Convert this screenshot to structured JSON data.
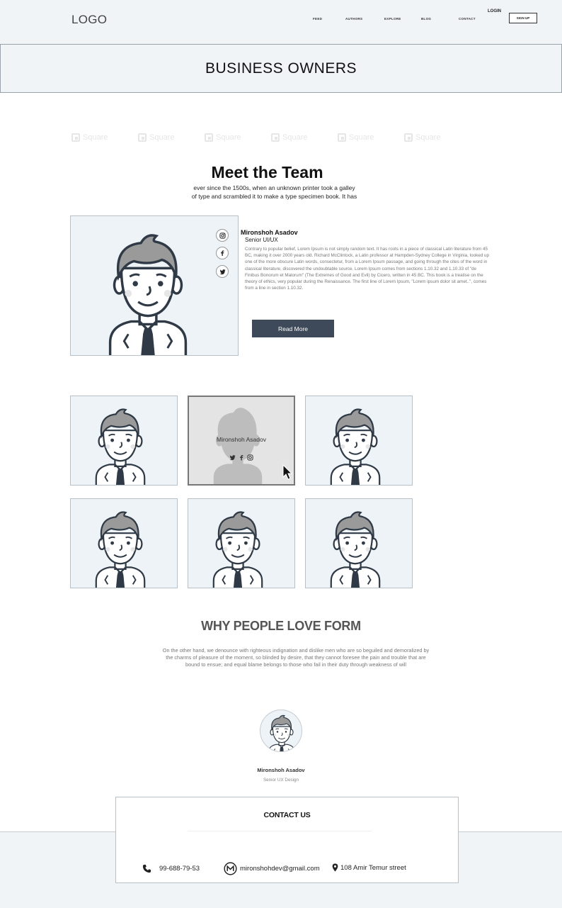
{
  "header": {
    "logo": "LOGO",
    "nav": [
      "FEED",
      "AUTHORS",
      "EXPLORE",
      "BLOG",
      "CONTACT"
    ],
    "login": "LOGIN",
    "signup": "SIGN UP"
  },
  "banner": {
    "title": "BUSINESS OWNERS"
  },
  "watermark": {
    "label": "Square",
    "count": 6
  },
  "team": {
    "title": "Meet the Team",
    "subtitle": "ever since the 1500s, when an unknown printer took a galley of type and scrambled it to make a type specimen book. It has",
    "featured": {
      "name": "Mironshoh Asadov",
      "role": "Senior UI/UX",
      "bio": "Contrary to popular belief, Lorem Ipsum is not simply random text. It has roots in a piece of classical Latin literature from 45 BC, making it over 2000 years old. Richard McClintock, a Latin professor at Hampden-Sydney College in Virginia, looked up one of the more obscure Latin words, consectetur, from a Lorem Ipsum passage, and going through the cites of the word in classical literature, discovered the undoubtable source. Lorem Ipsum comes from sections 1.10.32 and 1.10.33 of \"de Finibus Bonorum et Malorum\" (The Extremes of Good and Evil) by Cicero, written in 45 BC. This book is a treatise on the theory of ethics, very popular during the Renaissance. The first line of Lorem Ipsum, \"Lorem ipsum dolor sit amet..\", comes from a line in section 1.10.32.",
      "read_more": "Read More",
      "social_icons": [
        "instagram-icon",
        "facebook-icon",
        "twitter-icon"
      ]
    },
    "hover_card_name": "Mironshoh Asadov"
  },
  "why": {
    "title": "WHY PEOPLE LOVE FORM",
    "text": "On the other hand, we denounce with righteous indignation and dislike men who are so beguiled and demoralized by the charms of pleasure of the moment, so blinded by desire, that they cannot foresee the pain and trouble that are bound to ensue; and equal blame belongs to those who fail in their duty through weakness of will"
  },
  "testimonial": {
    "name": "Mironshoh Asadov",
    "role": "Senior UX Design"
  },
  "contact": {
    "title": "CONTACT US",
    "phone": "99-688-79-53",
    "email": "mironshohdev@gmail.com",
    "address": "108 Amir Temur street"
  },
  "colors": {
    "button": "#3e4959",
    "header_bg": "#f0f4f7",
    "card_bg": "#eef3f7"
  }
}
